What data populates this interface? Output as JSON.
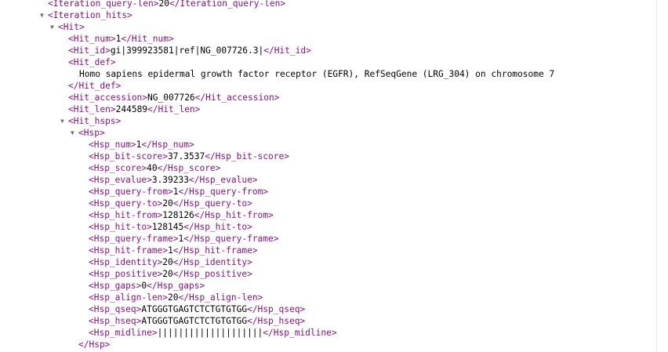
{
  "xml": {
    "query_len": {
      "open": "<Iteration_query-len>",
      "value": "20",
      "close": "</Iteration_query-len>"
    },
    "iteration_hits_open": "<Iteration_hits>",
    "hit_open": "<Hit>",
    "hit_num": {
      "open": "<Hit_num>",
      "value": "1",
      "close": "</Hit_num>"
    },
    "hit_id": {
      "open": "<Hit_id>",
      "value": "gi|399923581|ref|NG_007726.3|",
      "close": "</Hit_id>"
    },
    "hit_def_open": "<Hit_def>",
    "hit_def_text": "Homo sapiens epidermal growth factor receptor (EGFR), RefSeqGene (LRG_304) on chromosome 7",
    "hit_def_close": "</Hit_def>",
    "hit_accession": {
      "open": "<Hit_accession>",
      "value": "NG_007726",
      "close": "</Hit_accession>"
    },
    "hit_len": {
      "open": "<Hit_len>",
      "value": "244589",
      "close": "</Hit_len>"
    },
    "hit_hsps_open": "<Hit_hsps>",
    "hsp_open": "<Hsp>",
    "hsp_fields": [
      {
        "open": "<Hsp_num>",
        "value": "1",
        "close": "</Hsp_num>"
      },
      {
        "open": "<Hsp_bit-score>",
        "value": "37.3537",
        "close": "</Hsp_bit-score>"
      },
      {
        "open": "<Hsp_score>",
        "value": "40",
        "close": "</Hsp_score>"
      },
      {
        "open": "<Hsp_evalue>",
        "value": "3.39233",
        "close": "</Hsp_evalue>"
      },
      {
        "open": "<Hsp_query-from>",
        "value": "1",
        "close": "</Hsp_query-from>"
      },
      {
        "open": "<Hsp_query-to>",
        "value": "20",
        "close": "</Hsp_query-to>"
      },
      {
        "open": "<Hsp_hit-from>",
        "value": "128126",
        "close": "</Hsp_hit-from>"
      },
      {
        "open": "<Hsp_hit-to>",
        "value": "128145",
        "close": "</Hsp_hit-to>"
      },
      {
        "open": "<Hsp_query-frame>",
        "value": "1",
        "close": "</Hsp_query-frame>"
      },
      {
        "open": "<Hsp_hit-frame>",
        "value": "1",
        "close": "</Hsp_hit-frame>"
      },
      {
        "open": "<Hsp_identity>",
        "value": "20",
        "close": "</Hsp_identity>"
      },
      {
        "open": "<Hsp_positive>",
        "value": "20",
        "close": "</Hsp_positive>"
      },
      {
        "open": "<Hsp_gaps>",
        "value": "0",
        "close": "</Hsp_gaps>"
      },
      {
        "open": "<Hsp_align-len>",
        "value": "20",
        "close": "</Hsp_align-len>"
      },
      {
        "open": "<Hsp_qseq>",
        "value": "ATGGGTGAGTCTCTGTGTGG",
        "close": "</Hsp_qseq>"
      },
      {
        "open": "<Hsp_hseq>",
        "value": "ATGGGTGAGTCTCTGTGTGG",
        "close": "</Hsp_hseq>"
      },
      {
        "open": "<Hsp_midline>",
        "value": "||||||||||||||||||||",
        "close": "</Hsp_midline>"
      }
    ],
    "hsp_close": "</Hsp>"
  },
  "icons": {
    "expanded": "triangle-down-icon"
  },
  "colors": {
    "tag": "#881280",
    "text": "#000000",
    "toggle": "#6e6e6e"
  }
}
